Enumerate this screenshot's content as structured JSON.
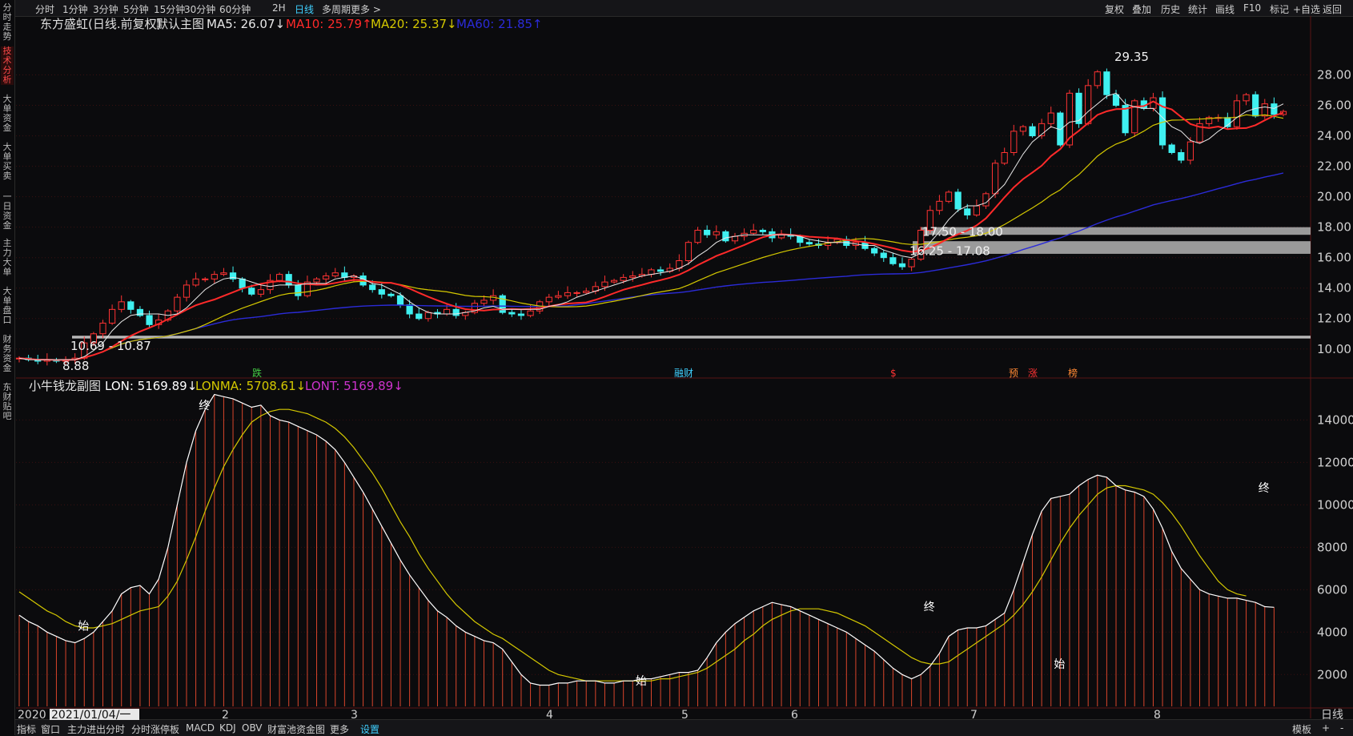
{
  "left_rail": [
    "分时走势",
    "技术分析",
    "大单资金",
    "大单买卖",
    "一日资金",
    "主力大单",
    "大单盘口",
    "财务资金",
    "东财贴吧"
  ],
  "left_rail_active": 1,
  "top_tabs": [
    "分时",
    "1分钟",
    "3分钟",
    "5分钟",
    "15分钟",
    "30分钟",
    "60分钟",
    "2H",
    "日线",
    "多周期",
    "更多 >"
  ],
  "top_tabs_active": 8,
  "top_right": [
    "复权",
    "叠加",
    "历史",
    "统计",
    "画线",
    "F10",
    "标记",
    "+自选",
    "返回"
  ],
  "bottom_tabs": [
    "指标",
    "窗口",
    "主力进出分时",
    "分时涨停板",
    "MACD",
    "KDJ",
    "OBV",
    "财富池资金图",
    "更多",
    "设置"
  ],
  "bottom_tabs_active": 9,
  "bottom_right": [
    "模板",
    "+",
    "-"
  ],
  "colors": {
    "up": "#ff3333",
    "down": "#3ff0f0",
    "ma5": "#e8e8e8",
    "ma10": "#ff2a2a",
    "ma20": "#d4c800",
    "ma60": "#2b2bd8",
    "lon": "#ffffff",
    "lonma": "#d4c800",
    "lont": "#cc33cc",
    "bars": "#d9452b",
    "grid": "#3a1010"
  },
  "main_legend": {
    "title": "东方盛虹(日线.前复权)",
    "default": "默认主图",
    "ma5": "MA5: 26.07↓",
    "ma10": "MA10: 25.79↑",
    "ma20": "MA20: 25.37↓",
    "ma60": "MA60: 21.85↑"
  },
  "sub_legend": {
    "title": "小牛钱龙副图",
    "lon": "LON: 5169.89↓",
    "lonma": "LONMA: 5708.61↓",
    "lont": "LONT: 5169.89↓"
  },
  "annotations": {
    "high": "29.35",
    "low": "8.88",
    "band1": "10.69 - 10.87",
    "band2": "16.25 - 17.08",
    "band3": "17.50 - 18.00",
    "event_labels": [
      "跌",
      "融财",
      "$",
      "预",
      "涨",
      "榜"
    ],
    "sub_labels": [
      "始",
      "终",
      "始",
      "终",
      "始",
      "终"
    ]
  },
  "chart_data": [
    {
      "type": "candlestick",
      "title": "东方盛虹(日线.前复权)",
      "y_ticks": [
        "28.00",
        "26.00",
        "24.00",
        "22.00",
        "20.00",
        "18.00",
        "16.00",
        "14.00",
        "12.00",
        "10.00"
      ],
      "ylim": [
        8.2,
        30.5
      ],
      "period_label": "日线",
      "x_ticks": [
        "2020",
        "2021/01/04/一",
        "2",
        "3",
        "4",
        "5",
        "6",
        "7",
        "8"
      ],
      "close": [
        9.4,
        9.3,
        9.2,
        9.3,
        9.2,
        9.3,
        9.4,
        10.4,
        11.0,
        11.7,
        12.6,
        13.1,
        12.6,
        12.2,
        11.6,
        11.9,
        12.5,
        13.4,
        14.2,
        14.6,
        14.6,
        14.9,
        15.0,
        14.6,
        14.0,
        13.6,
        13.9,
        14.5,
        14.9,
        14.2,
        13.5,
        14.4,
        14.6,
        14.8,
        15.0,
        14.7,
        14.8,
        14.2,
        13.9,
        13.6,
        13.5,
        12.9,
        12.3,
        12.0,
        12.4,
        12.3,
        12.6,
        12.2,
        12.4,
        13.0,
        13.2,
        13.5,
        12.4,
        12.3,
        12.2,
        12.5,
        13.1,
        13.4,
        13.5,
        13.7,
        13.7,
        13.8,
        14.1,
        14.4,
        14.5,
        14.7,
        14.8,
        14.9,
        15.2,
        15.1,
        15.3,
        15.8,
        17.0,
        17.8,
        17.5,
        17.7,
        17.1,
        17.4,
        17.6,
        17.8,
        17.7,
        17.3,
        17.5,
        17.4,
        17.0,
        16.9,
        16.8,
        17.0,
        17.2,
        16.8,
        17.0,
        16.6,
        16.3,
        16.0,
        15.6,
        15.4,
        15.9,
        17.8,
        19.1,
        19.7,
        20.3,
        19.2,
        18.8,
        19.4,
        20.2,
        22.2,
        22.9,
        24.3,
        24.6,
        24.0,
        24.8,
        25.5,
        23.4,
        26.8,
        24.8,
        27.3,
        28.2,
        26.7,
        26.0,
        24.2,
        26.3,
        25.8,
        26.5,
        23.4,
        22.9,
        22.4,
        23.6,
        24.8,
        25.2,
        25.2,
        24.6,
        26.3,
        26.7,
        25.3,
        26.1,
        25.4,
        25.6
      ],
      "ma5": [
        9.4,
        9.3,
        9.3,
        9.3,
        9.3,
        9.3,
        9.3,
        9.5,
        9.9,
        10.4,
        11.2,
        11.8,
        12.2,
        12.3,
        12.3,
        12.3,
        12.2,
        12.3,
        12.7,
        13.3,
        13.9,
        14.3,
        14.6,
        14.7,
        14.6,
        14.4,
        14.2,
        14.1,
        14.2,
        14.2,
        14.2,
        14.3,
        14.3,
        14.3,
        14.6,
        14.7,
        14.8,
        14.6,
        14.3,
        14.2,
        13.9,
        13.6,
        13.1,
        12.7,
        12.4,
        12.3,
        12.3,
        12.3,
        12.4,
        12.5,
        12.7,
        12.8,
        12.6,
        12.6,
        12.6,
        12.6,
        12.6,
        12.8,
        12.9,
        13.1,
        13.4,
        13.6,
        13.8,
        14.0,
        14.2,
        14.4,
        14.6,
        14.8,
        14.9,
        15.0,
        15.1,
        15.3,
        15.6,
        16.1,
        16.5,
        17.0,
        17.3,
        17.4,
        17.5,
        17.5,
        17.5,
        17.5,
        17.5,
        17.5,
        17.4,
        17.2,
        17.1,
        17.0,
        17.0,
        17.0,
        16.9,
        16.8,
        16.8,
        16.5,
        16.3,
        16.1,
        16.0,
        16.3,
        17.0,
        17.7,
        18.5,
        19.1,
        19.4,
        19.4,
        19.6,
        20.2,
        20.8,
        21.8,
        22.8,
        23.6,
        24.1,
        24.6,
        24.4,
        24.9,
        25.0,
        25.6,
        26.1,
        26.6,
        26.8,
        26.1,
        25.9,
        25.8,
        25.8,
        25.2,
        24.6,
        24.3,
        23.7,
        23.5,
        23.8,
        24.3,
        24.7,
        25.2,
        25.6,
        25.8,
        25.9,
        25.8,
        26.1
      ]
    },
    {
      "type": "bar",
      "title": "小牛钱龙副图",
      "y_ticks": [
        "14000",
        "12000",
        "10000",
        "8000",
        "6000",
        "4000",
        "2000"
      ],
      "ylim": [
        500,
        15300
      ],
      "lon": [
        4800,
        4500,
        4300,
        4000,
        3800,
        3600,
        3500,
        3700,
        4000,
        4500,
        5000,
        5800,
        6100,
        6200,
        5800,
        6500,
        8000,
        10000,
        12000,
        13500,
        14500,
        15200,
        15100,
        15000,
        14800,
        14600,
        14700,
        14200,
        14000,
        13900,
        13700,
        13500,
        13300,
        13000,
        12600,
        12000,
        11300,
        10600,
        9800,
        9000,
        8200,
        7400,
        6700,
        6100,
        5500,
        5000,
        4700,
        4300,
        4000,
        3800,
        3600,
        3500,
        3200,
        2600,
        2000,
        1600,
        1500,
        1500,
        1600,
        1600,
        1700,
        1700,
        1700,
        1600,
        1600,
        1700,
        1700,
        1800,
        1800,
        1900,
        2000,
        2100,
        2100,
        2200,
        2800,
        3500,
        4000,
        4400,
        4700,
        5000,
        5200,
        5400,
        5300,
        5200,
        5000,
        4800,
        4600,
        4400,
        4200,
        4000,
        3700,
        3400,
        3100,
        2700,
        2300,
        2000,
        1800,
        2000,
        2400,
        3000,
        3800,
        4100,
        4200,
        4200,
        4300,
        4600,
        4900,
        6000,
        7300,
        8600,
        9700,
        10300,
        10400,
        10500,
        10900,
        11200,
        11400,
        11300,
        10900,
        10700,
        10600,
        10400,
        9800,
        8900,
        7800,
        7000,
        6500,
        6000,
        5800,
        5700,
        5600,
        5600,
        5500,
        5400,
        5200,
        5170
      ],
      "lonma": [
        5900,
        5600,
        5300,
        5000,
        4800,
        4500,
        4300,
        4200,
        4200,
        4300,
        4400,
        4600,
        4800,
        5000,
        5100,
        5200,
        5700,
        6400,
        7400,
        8500,
        9700,
        10800,
        11800,
        12600,
        13300,
        13900,
        14200,
        14400,
        14500,
        14500,
        14400,
        14300,
        14100,
        13900,
        13600,
        13200,
        12700,
        12100,
        11500,
        10800,
        10000,
        9200,
        8500,
        7700,
        7000,
        6400,
        5800,
        5300,
        4900,
        4500,
        4200,
        3900,
        3700,
        3400,
        3100,
        2800,
        2500,
        2200,
        2000,
        1900,
        1800,
        1700,
        1700,
        1700,
        1700,
        1700,
        1700,
        1700,
        1700,
        1800,
        1800,
        1900,
        2000,
        2100,
        2300,
        2600,
        2900,
        3200,
        3600,
        3900,
        4300,
        4600,
        4800,
        5000,
        5100,
        5100,
        5100,
        5000,
        4900,
        4700,
        4500,
        4300,
        4000,
        3700,
        3400,
        3100,
        2800,
        2600,
        2500,
        2500,
        2600,
        2900,
        3200,
        3500,
        3800,
        4100,
        4400,
        4800,
        5300,
        5900,
        6600,
        7400,
        8200,
        8900,
        9500,
        10000,
        10500,
        10800,
        10900,
        10900,
        10800,
        10700,
        10500,
        10100,
        9600,
        9000,
        8300,
        7600,
        7000,
        6400,
        6000,
        5800,
        5708
      ]
    }
  ]
}
